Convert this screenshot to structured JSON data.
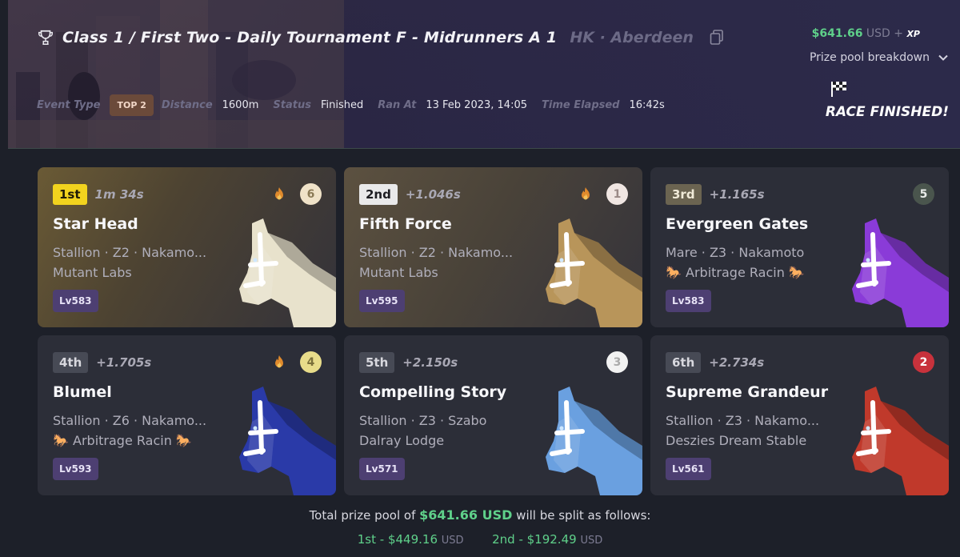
{
  "header": {
    "title": "Class 1 / First Two - Daily Tournament F - Midrunners A 1",
    "track": "HK · Aberdeen",
    "prize_amount": "$641.66",
    "prize_currency": "USD",
    "prize_plus": "+",
    "prize_xp": "XP",
    "breakdown_label": "Prize pool breakdown",
    "meta": {
      "event_type_label": "Event Type",
      "event_type_value": "TOP 2",
      "distance_label": "Distance",
      "distance_value": "1600m",
      "status_label": "Status",
      "status_value": "Finished",
      "ran_at_label": "Ran At",
      "ran_at_value": "13 Feb 2023, 14:05",
      "elapsed_label": "Time Elapsed",
      "elapsed_value": "16:42s"
    },
    "race_finished": "RACE FINISHED!"
  },
  "results": [
    {
      "position": "1st",
      "time": "1m 34s",
      "name": "Star Head",
      "info": "Stallion · Z2 · Nakamo...",
      "stable": "Mutant Labs",
      "level": "Lv583",
      "number": "6",
      "fire": true,
      "num_color": "#efe2c8",
      "num_text": "#8a7a56",
      "horse_color": "#e8e2cc",
      "badge": "p1",
      "card": "gold"
    },
    {
      "position": "2nd",
      "time": "+1.046s",
      "name": "Fifth Force",
      "info": "Stallion · Z2 · Nakamo...",
      "stable": "Mutant Labs",
      "level": "Lv595",
      "number": "1",
      "fire": true,
      "num_color": "#f0e6e2",
      "num_text": "#9a8a86",
      "horse_color": "#b8955a",
      "badge": "p2",
      "card": "silver"
    },
    {
      "position": "3rd",
      "time": "+1.165s",
      "name": "Evergreen Gates",
      "info": "Mare · Z3 · Nakamoto",
      "stable": "🐎 Arbitrage Racin 🐎",
      "level": "Lv583",
      "number": "5",
      "fire": false,
      "num_color": "#4a554d",
      "num_text": "#e9ece9",
      "horse_color": "#8a3bd8",
      "badge": "p3",
      "card": "plain"
    },
    {
      "position": "4th",
      "time": "+1.705s",
      "name": "Blumel",
      "info": "Stallion · Z6 · Nakamo...",
      "stable": "🐎 Arbitrage Racin 🐎",
      "level": "Lv593",
      "number": "4",
      "fire": true,
      "num_color": "#e8dc8a",
      "num_text": "#7a6f3a",
      "horse_color": "#2a3aa8",
      "badge": "pn",
      "card": "plain"
    },
    {
      "position": "5th",
      "time": "+2.150s",
      "name": "Compelling Story",
      "info": "Stallion · Z3 · Szabo",
      "stable": "Dalray Lodge",
      "level": "Lv571",
      "number": "3",
      "fire": false,
      "num_color": "#f2f2f2",
      "num_text": "#aaaaaa",
      "horse_color": "#6aa0e0",
      "badge": "pn",
      "card": "plain"
    },
    {
      "position": "6th",
      "time": "+2.734s",
      "name": "Supreme Grandeur",
      "info": "Stallion · Z3 · Nakamo...",
      "stable": "Deszies Dream Stable",
      "level": "Lv561",
      "number": "2",
      "fire": false,
      "num_color": "#c8323c",
      "num_text": "#ffffff",
      "horse_color": "#c0392b",
      "badge": "pn",
      "card": "plain"
    }
  ],
  "footer": {
    "text_before": "Total prize pool of",
    "amount": "$641.66 USD",
    "text_after": "will be split as follows:",
    "split_1_label": "1st - $449.16",
    "split_1_currency": "USD",
    "split_2_label": "2nd - $192.49",
    "split_2_currency": "USD"
  }
}
